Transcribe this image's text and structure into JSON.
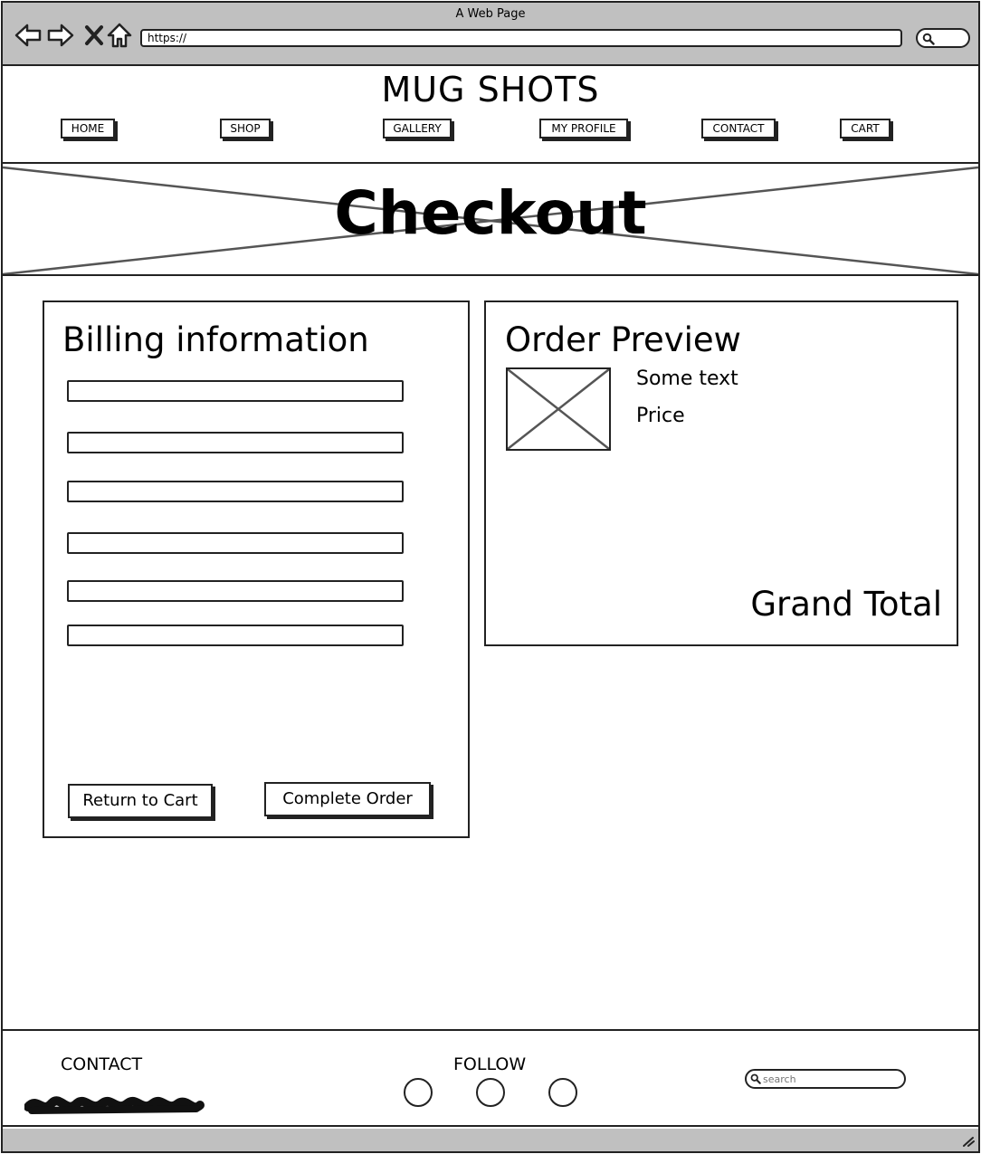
{
  "browser": {
    "title": "A Web Page",
    "url": "https://"
  },
  "header": {
    "site_title": "MUG SHOTS",
    "nav": [
      {
        "label": "HOME"
      },
      {
        "label": "SHOP"
      },
      {
        "label": "GALLERY"
      },
      {
        "label": "MY PROFILE"
      },
      {
        "label": "CONTACT"
      },
      {
        "label": "CART"
      }
    ]
  },
  "hero": {
    "title": "Checkout"
  },
  "billing": {
    "title": "Billing information",
    "fields": [
      "",
      "",
      "",
      "",
      "",
      ""
    ],
    "return_label": "Return to Cart",
    "complete_label": "Complete Order"
  },
  "preview": {
    "title": "Order Preview",
    "item_text": "Some text",
    "item_price": "Price",
    "grand_total": "Grand Total"
  },
  "footer": {
    "contact_label": "CONTACT",
    "follow_label": "FOLLOW",
    "search_placeholder": "search"
  },
  "colors": {
    "chrome": "#c0c0c0",
    "ink": "#222222",
    "background": "#ffffff"
  }
}
